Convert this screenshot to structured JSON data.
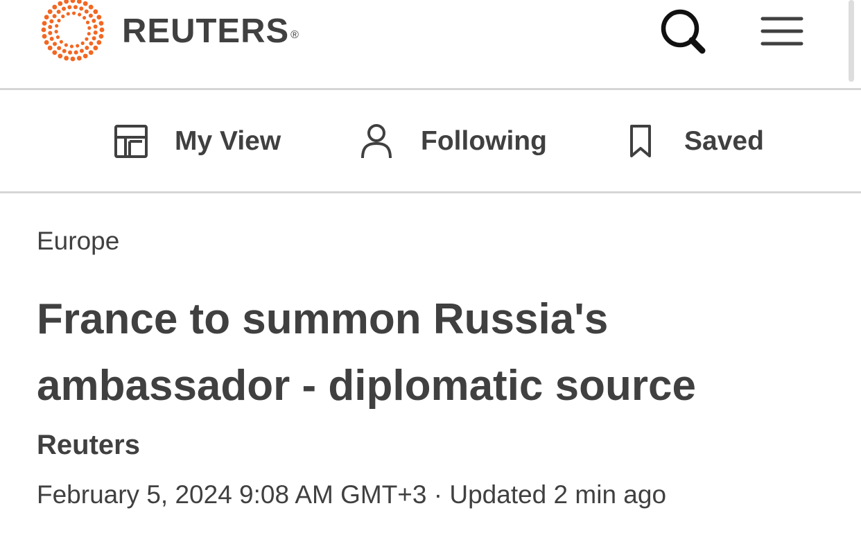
{
  "header": {
    "brand_name": "REUTERS",
    "brand_mark": "®",
    "logo_icon": "reuters-dot-ring-logo",
    "search_icon": "magnifier-icon",
    "menu_icon": "hamburger-menu-icon",
    "accent_color": "#f26722",
    "text_color": "#404040"
  },
  "subnav": {
    "items": [
      {
        "label": "My View",
        "icon": "layout-icon"
      },
      {
        "label": "Following",
        "icon": "person-icon"
      },
      {
        "label": "Saved",
        "icon": "bookmark-icon"
      }
    ]
  },
  "article": {
    "section": "Europe",
    "headline": "France to summon Russia's ambassador - diplomatic source",
    "byline": "Reuters",
    "published": "February 5, 2024 9:08 AM GMT+3",
    "separator": "·",
    "updated": "Updated 2 min ago"
  }
}
